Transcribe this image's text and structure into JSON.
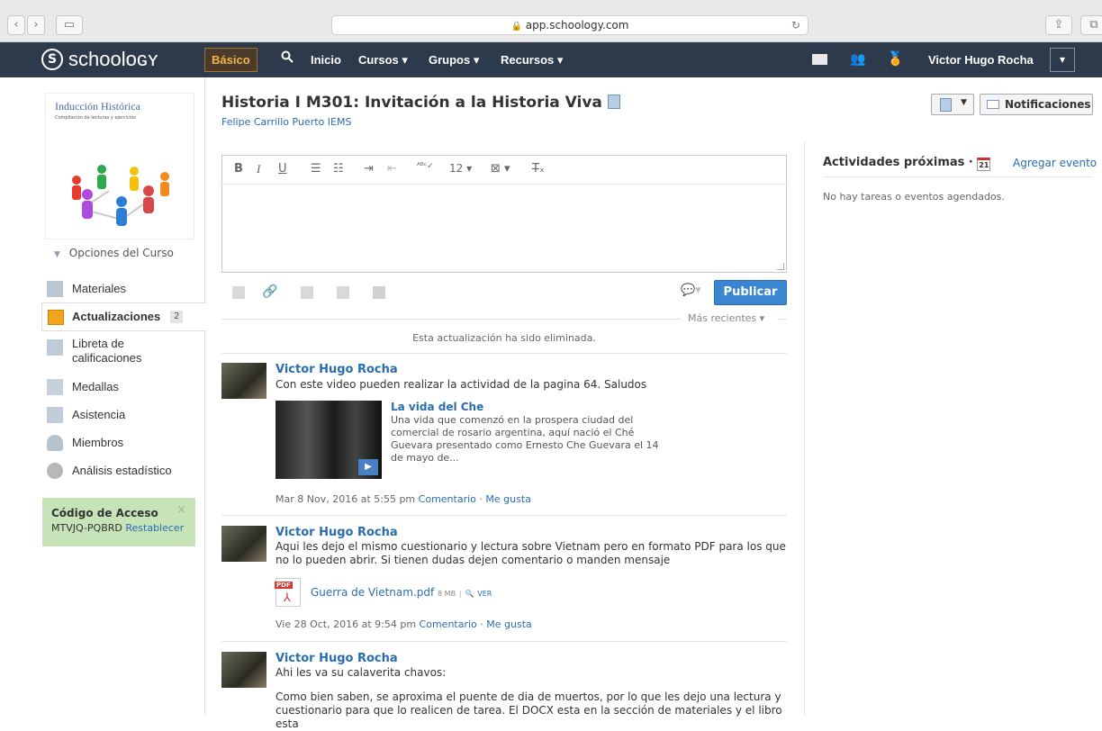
{
  "browser": {
    "url": "app.schoology.com"
  },
  "nav": {
    "logo_text": "schoolᴏɢʏ",
    "basic_label": "Básico",
    "items": [
      "Inicio",
      "Cursos ▾",
      "Grupos ▾",
      "Recursos ▾"
    ],
    "user_name": "Victor Hugo Rocha",
    "caret": "▾"
  },
  "course": {
    "title": "Historia I M301: Invitación a la Historia Viva",
    "school": "Felipe Carrillo Puerto IEMS",
    "cover_title": "Inducción Histórica",
    "cover_subtitle": "Compilación de lecturas y ejercicios",
    "options_label": "Opciones del Curso",
    "notifications_label": "Notificaciones"
  },
  "sidebar": {
    "items": [
      {
        "label": "Materiales"
      },
      {
        "label": "Actualizaciones",
        "badge": "2"
      },
      {
        "label": "Libreta de calificaciones"
      },
      {
        "label": "Medallas"
      },
      {
        "label": "Asistencia"
      },
      {
        "label": "Miembros"
      },
      {
        "label": "Análisis estadístico"
      }
    ],
    "access": {
      "title": "Código de Acceso",
      "code": "MTVJQ-PQBRD",
      "reset": "Restablecer",
      "close": "×"
    }
  },
  "editor": {
    "font_size": "12",
    "publish_label": "Publicar",
    "sort_label": "Más recientes ▾"
  },
  "feed": {
    "deleted_notice": "Esta actualización ha sido eliminada.",
    "posts": [
      {
        "author": "Victor Hugo Rocha",
        "text": "Con este video pueden realizar la actividad de la pagina 64. Saludos",
        "video_title": "La vida del Che",
        "video_desc": "Una vida que comenzó en la prospera ciudad del comercial de rosario argentina, aquí nació el Ché Guevara presentado como Ernesto Che Guevara el 14 de mayo de...",
        "date": "Mar 8 Nov, 2016 at 5:55 pm",
        "comment": "Comentario",
        "like": "Me gusta"
      },
      {
        "author": "Victor Hugo Rocha",
        "text": "Aqui les dejo el mismo cuestionario y lectura sobre Vietnam pero en formato PDF para los que no lo pueden abrir. Si tienen dudas dejen comentario o manden mensaje",
        "file_name": "Guerra de Vietnam.pdf",
        "file_size": "8 MB",
        "file_view": "VER",
        "date": "Vie 28 Oct, 2016 at 9:54 pm",
        "comment": "Comentario",
        "like": "Me gusta"
      },
      {
        "author": "Victor Hugo Rocha",
        "text": "Ahi les va su calaverita chavos:",
        "text2": "Como bien saben, se aproxima el puente de dia de muertos, por lo que les dejo una lectura y cuestionario para que lo realicen de tarea. El DOCX esta en la sección de materiales y el libro esta"
      }
    ]
  },
  "upcoming": {
    "title": "Actividades próximas ·",
    "cal_day": "21",
    "add_event": "Agregar evento",
    "empty": "No hay tareas o eventos agendados."
  }
}
